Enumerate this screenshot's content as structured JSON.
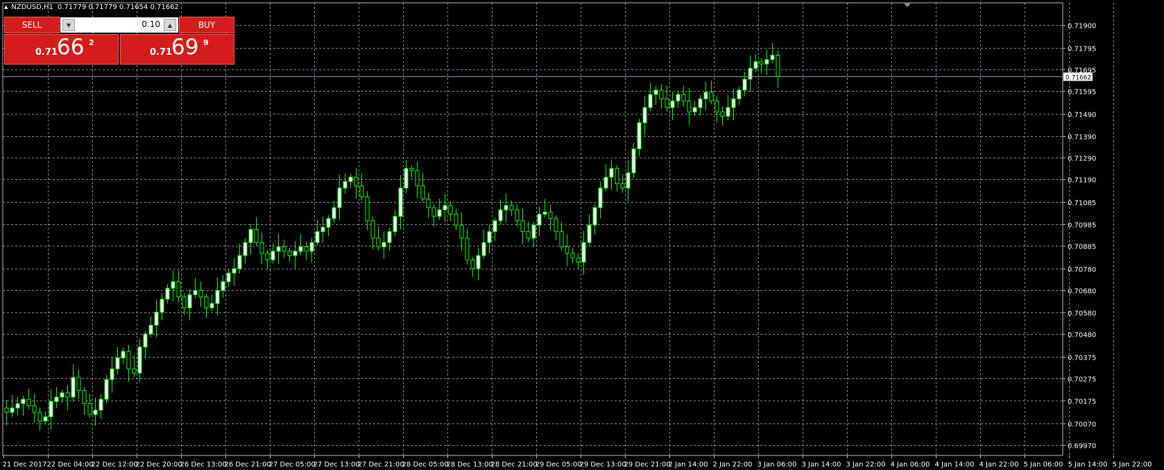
{
  "header": {
    "symbol": "NZDUSD,H1",
    "ohlc": "0.71779 0.71779 0.71654 0.71662"
  },
  "trade_panel": {
    "sell_label": "SELL",
    "buy_label": "BUY",
    "lot_size": "0.10",
    "sell_price_prefix": "0.71",
    "sell_price_big": "66",
    "sell_price_sup": "2",
    "buy_price_prefix": "0.71",
    "buy_price_big": "69",
    "buy_price_sup": "9"
  },
  "colors": {
    "background": "#000000",
    "grid": "#8c8c8c",
    "candle": "#00ff00",
    "bull_body": "#ffffff",
    "bid_line": "#8c9aa8",
    "button_red": "#d41c1c"
  },
  "chart_data": {
    "type": "candlestick",
    "ylim": [
      0.6997,
      0.7195
    ],
    "yticks": [
      "0.71900",
      "0.71795",
      "0.71695",
      "0.71595",
      "0.71490",
      "0.71390",
      "0.71290",
      "0.71190",
      "0.71085",
      "0.70985",
      "0.70885",
      "0.70780",
      "0.70680",
      "0.70580",
      "0.70480",
      "0.70375",
      "0.70275",
      "0.70175",
      "0.70070",
      "0.69970"
    ],
    "xticks": [
      "21 Dec 2017",
      "22 Dec 04:00",
      "22 Dec 12:00",
      "22 Dec 20:00",
      "26 Dec 13:00",
      "26 Dec 21:00",
      "27 Dec 05:00",
      "27 Dec 13:00",
      "27 Dec 21:00",
      "28 Dec 05:00",
      "28 Dec 13:00",
      "28 Dec 21:00",
      "29 Dec 05:00",
      "29 Dec 13:00",
      "29 Dec 21:00",
      "2 Jan 14:00",
      "2 Jan 22:00",
      "3 Jan 06:00",
      "3 Jan 14:00",
      "3 Jan 22:00",
      "4 Jan 06:00",
      "4 Jan 14:00",
      "4 Jan 22:00",
      "5 Jan 06:00",
      "5 Jan 14:00",
      "5 Jan 22:00"
    ],
    "current_price": "0.71662",
    "grid": true,
    "candles_per_xtick": 8,
    "close_path": [
      0.7012,
      0.7014,
      0.7016,
      0.7018,
      0.7015,
      0.7012,
      0.7008,
      0.701,
      0.7017,
      0.7019,
      0.7021,
      0.7019,
      0.7028,
      0.7022,
      0.7016,
      0.7011,
      0.7013,
      0.7018,
      0.7027,
      0.7032,
      0.7037,
      0.704,
      0.7032,
      0.703,
      0.7042,
      0.7048,
      0.7052,
      0.7058,
      0.7064,
      0.7069,
      0.7072,
      0.7065,
      0.706,
      0.7066,
      0.7068,
      0.7065,
      0.706,
      0.7062,
      0.7068,
      0.7072,
      0.7076,
      0.7078,
      0.7084,
      0.709,
      0.7096,
      0.709,
      0.7085,
      0.7082,
      0.7086,
      0.7088,
      0.7086,
      0.7084,
      0.7086,
      0.7088,
      0.7086,
      0.709,
      0.7095,
      0.7097,
      0.7101,
      0.7106,
      0.7115,
      0.7118,
      0.712,
      0.7116,
      0.7111,
      0.71,
      0.7092,
      0.7088,
      0.709,
      0.7095,
      0.7102,
      0.7115,
      0.7124,
      0.7123,
      0.7116,
      0.711,
      0.7106,
      0.7102,
      0.7105,
      0.7107,
      0.7103,
      0.7098,
      0.7092,
      0.7082,
      0.7078,
      0.7084,
      0.709,
      0.7095,
      0.71,
      0.7105,
      0.7107,
      0.7105,
      0.71,
      0.7095,
      0.7092,
      0.7098,
      0.7103,
      0.7104,
      0.7101,
      0.7095,
      0.7088,
      0.7085,
      0.7083,
      0.7081,
      0.709,
      0.7098,
      0.7106,
      0.7115,
      0.712,
      0.7124,
      0.7117,
      0.7115,
      0.7122,
      0.7133,
      0.7145,
      0.7152,
      0.7158,
      0.716,
      0.7156,
      0.7152,
      0.7155,
      0.7158,
      0.7155,
      0.715,
      0.7152,
      0.7156,
      0.7159,
      0.7155,
      0.715,
      0.7148,
      0.7152,
      0.7156,
      0.716,
      0.7165,
      0.717,
      0.7173,
      0.7172,
      0.7174,
      0.7176,
      0.71662
    ]
  }
}
